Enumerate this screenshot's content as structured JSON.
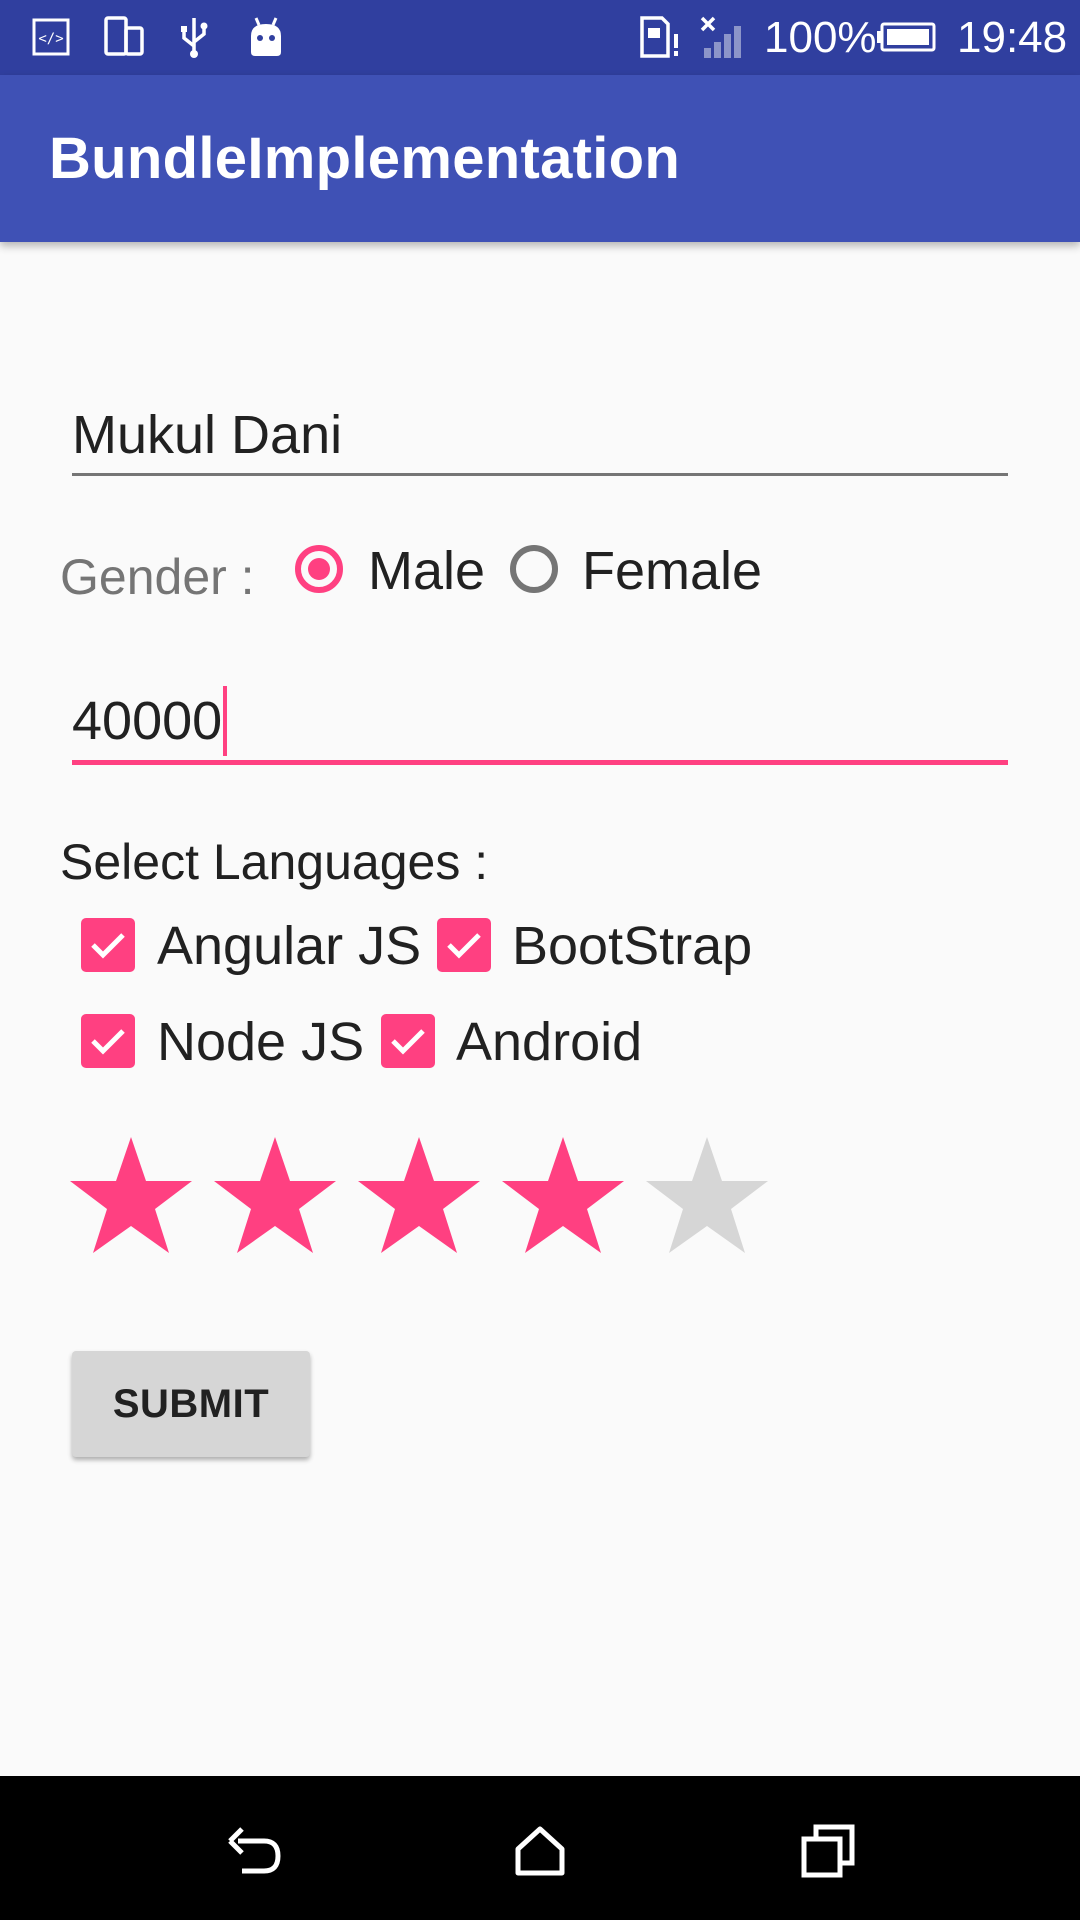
{
  "status_bar": {
    "icons": [
      "code-icon",
      "phone-rotate-icon",
      "usb-icon",
      "android-debug-icon",
      "sd-card-alert-icon",
      "signal-off-icon",
      "battery-icon"
    ],
    "battery": "100%",
    "time": "19:48"
  },
  "app_bar": {
    "title": "BundleImplementation"
  },
  "form": {
    "name_value": "Mukul Dani",
    "gender_label": "Gender :",
    "gender_options": [
      "Male",
      "Female"
    ],
    "gender_selected": "Male",
    "salary_value": "40000",
    "languages_label": "Select Languages :",
    "languages": [
      {
        "label": "Angular JS",
        "checked": true
      },
      {
        "label": "BootStrap",
        "checked": true
      },
      {
        "label": "Node JS",
        "checked": true
      },
      {
        "label": "Android",
        "checked": true
      }
    ],
    "rating": 4,
    "rating_max": 5,
    "submit_label": "SUBMIT"
  },
  "colors": {
    "status_bar": "#303f9f",
    "app_bar": "#3f51b5",
    "accent": "#ff4081",
    "star_empty": "#d6d6d6"
  },
  "nav_bar": {
    "icons": [
      "back-icon",
      "home-icon",
      "recents-icon"
    ]
  }
}
